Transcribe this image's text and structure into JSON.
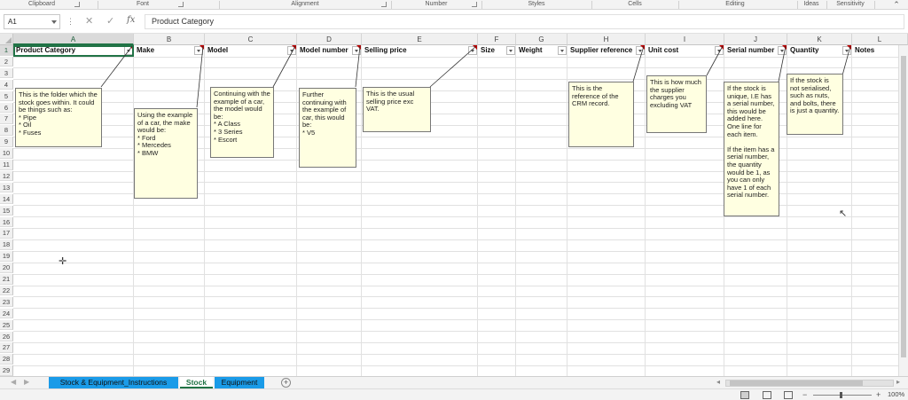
{
  "ribbon": {
    "groups": [
      "Clipboard",
      "Font",
      "Alignment",
      "Number",
      "Styles",
      "Cells",
      "Editing",
      "Ideas",
      "Sensitivity"
    ]
  },
  "formula_bar": {
    "name_box": "A1",
    "formula": "Product Category",
    "fx_icon": "fx"
  },
  "columns": [
    "A",
    "B",
    "C",
    "D",
    "E",
    "F",
    "G",
    "H",
    "I",
    "J",
    "K",
    "L"
  ],
  "rows": [
    "1",
    "2",
    "3",
    "4",
    "5",
    "6",
    "7",
    "8",
    "9",
    "10",
    "11",
    "12",
    "13",
    "14",
    "15",
    "16",
    "17",
    "18",
    "19",
    "20",
    "21",
    "22",
    "23",
    "24",
    "25",
    "26",
    "27",
    "28",
    "29"
  ],
  "headers": [
    "Product Category",
    "Make",
    "Model",
    "Model number",
    "Selling price",
    "Size",
    "Weight",
    "Supplier reference",
    "Unit cost",
    "Serial number",
    "Quantity",
    "Notes"
  ],
  "comments": {
    "product_category": "This is the folder which the stock goes within. It could be things such as:\n* Pipe\n* Oil\n* Fuses",
    "make": "Using the example of a car, the make would be:\n* Ford\n* Mercedes\n* BMW",
    "model": "Continuing with the example of a car, the model would be:\n* A Class\n* 3 Series\n* Escort",
    "model_number": "Further continuing with the example of car, this would be:\n* V5",
    "selling_price": "This is the usual selling price exc VAT.",
    "supplier_reference": "This is the reference of the CRM record.",
    "unit_cost": "This is how much the supplier charges you excluding VAT",
    "serial_number": "If the stock is unique, I.E has a serial number, this would be added here. One line for each item.\n\nIf the item has a serial number, the quantity would be 1, as you can only have 1 of each serial number.",
    "quantity": "If the stock is not serialised, such as nuts, and bolts, there is just a quantity."
  },
  "sheet_tabs": {
    "tabs": [
      "Stock & Equipment_Instructions",
      "Stock",
      "Equipment"
    ],
    "active": "Stock"
  },
  "status_bar": {
    "zoom": "100%"
  },
  "colors": {
    "accent": "#217346",
    "tab_blue": "#1a9be8",
    "note_bg": "#ffffe1",
    "comment_indicator": "#c00000"
  }
}
